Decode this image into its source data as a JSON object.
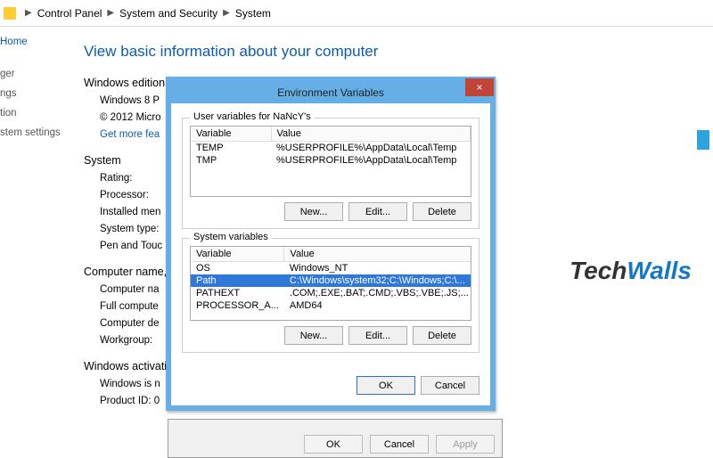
{
  "breadcrumb": {
    "seg0": "Control Panel",
    "seg1": "System and Security",
    "seg2": "System"
  },
  "sidebar": {
    "home": "Home",
    "i0": "ger",
    "i1": "ngs",
    "i2": "tion",
    "i3": "stem settings"
  },
  "pageTitle": "View basic information about your computer",
  "windowsEdition": {
    "head": "Windows edition",
    "ver": "Windows 8 P",
    "copy": "© 2012 Micro",
    "more": "Get more fea"
  },
  "systemSection": {
    "head": "System",
    "rating": "Rating:",
    "processor": "Processor:",
    "mem": "Installed men",
    "type": "System type:",
    "pen": "Pen and Touc"
  },
  "computerSection": {
    "head": "Computer name,",
    "name": "Computer na",
    "full": "Full compute",
    "desc": "Computer de",
    "wg": "Workgroup:"
  },
  "activation": {
    "head": "Windows activati",
    "status": "Windows is n",
    "pid": "Product ID: 0"
  },
  "brand": {
    "a": "Tech",
    "b": "Walls"
  },
  "backDlg": {
    "ok": "OK",
    "cancel": "Cancel",
    "apply": "Apply"
  },
  "envDlg": {
    "title": "Environment Variables",
    "close": "×",
    "userGroup": "User variables for NaNcY's",
    "sysGroup": "System variables",
    "colVar": "Variable",
    "colVal": "Value",
    "userVars": [
      {
        "var": "TEMP",
        "val": "%USERPROFILE%\\AppData\\Local\\Temp"
      },
      {
        "var": "TMP",
        "val": "%USERPROFILE%\\AppData\\Local\\Temp"
      }
    ],
    "sysVars": [
      {
        "var": "OS",
        "val": "Windows_NT"
      },
      {
        "var": "Path",
        "val": "C:\\Windows\\system32;C:\\Windows;C:\\..."
      },
      {
        "var": "PATHEXT",
        "val": ".COM;.EXE;.BAT;.CMD;.VBS;.VBE;.JS;..."
      },
      {
        "var": "PROCESSOR_A...",
        "val": "AMD64"
      }
    ],
    "sysSelected": 1,
    "new": "New...",
    "edit": "Edit...",
    "del": "Delete",
    "ok": "OK",
    "cancel": "Cancel"
  }
}
